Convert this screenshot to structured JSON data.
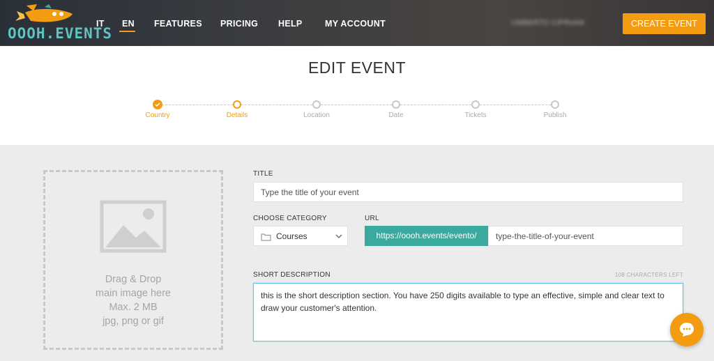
{
  "brand": {
    "name": "OOOH.EVENTS",
    "accent": "#f39c12",
    "teal": "#3aa99e"
  },
  "nav": {
    "lang_it": "IT",
    "lang_en": "EN",
    "features": "FEATURES",
    "pricing": "PRICING",
    "help": "HELP",
    "my_account": "MY ACCOUNT",
    "user_name": "UMBERTO CIPRIANI",
    "create_event": "CREATE EVENT"
  },
  "page": {
    "title": "EDIT EVENT"
  },
  "stepper": {
    "steps": [
      {
        "label": "Country",
        "state": "done"
      },
      {
        "label": "Details",
        "state": "active"
      },
      {
        "label": "Location",
        "state": "todo"
      },
      {
        "label": "Date",
        "state": "todo"
      },
      {
        "label": "Tickets",
        "state": "todo"
      },
      {
        "label": "Publish",
        "state": "todo"
      }
    ]
  },
  "dropzone": {
    "line1": "Drag & Drop",
    "line2": "main image here",
    "line3": "Max. 2 MB",
    "line4": "jpg, png or gif",
    "icon": "image-placeholder-icon"
  },
  "form": {
    "title_label": "TITLE",
    "title_placeholder": "Type the title of your event",
    "category_label": "CHOOSE CATEGORY",
    "category_value": "Courses",
    "url_label": "URL",
    "url_prefix": "https://oooh.events/evento/",
    "url_slug": "type-the-title-of-your-event",
    "short_desc_label": "SHORT DESCRIPTION",
    "chars_left": "108 CHARACTERS LEFT",
    "short_desc_value": "this is the short description section. You have 250 digits available to type an effective, simple and clear text to draw your customer's attention."
  },
  "chat": {
    "icon": "chat-bubble-icon"
  }
}
